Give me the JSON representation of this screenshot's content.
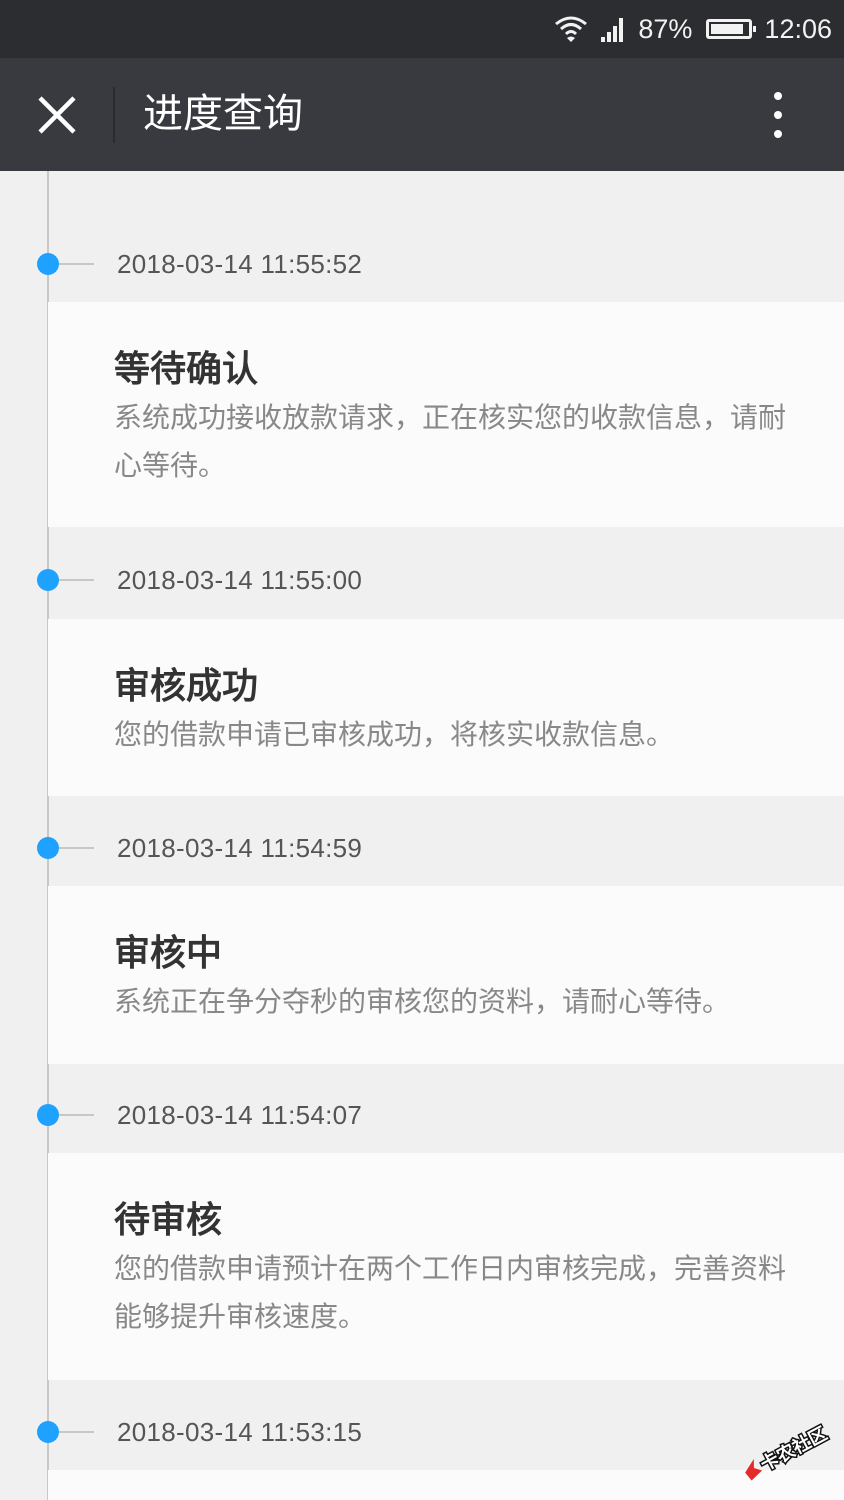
{
  "status": {
    "battery": "87%",
    "time": "12:06",
    "battery_level": 0.87,
    "icons": [
      "wifi-icon",
      "signal-icon",
      "battery-icon"
    ]
  },
  "nav": {
    "title": "进度查询",
    "close_icon": "close-icon",
    "more_icon": "more-vertical-icon"
  },
  "colors": {
    "accent": "#1fa1ff",
    "nav_bg": "#393a3f",
    "status_bg": "#2c2d31"
  },
  "timeline": [
    {
      "time": "2018-03-14 11:55:52",
      "title": "等待确认",
      "desc": "系统成功接收放款请求，正在核实您的收款信息，请耐心等待。"
    },
    {
      "time": "2018-03-14 11:55:00",
      "title": "审核成功",
      "desc": "您的借款申请已审核成功，将核实收款信息。"
    },
    {
      "time": "2018-03-14 11:54:59",
      "title": "审核中",
      "desc": "系统正在争分夺秒的审核您的资料，请耐心等待。"
    },
    {
      "time": "2018-03-14 11:54:07",
      "title": "待审核",
      "desc": "您的借款申请预计在两个工作日内审核完成，完善资料能够提升审核速度。"
    },
    {
      "time": "2018-03-14 11:53:15"
    }
  ],
  "watermark": {
    "text": "卡农社区"
  }
}
